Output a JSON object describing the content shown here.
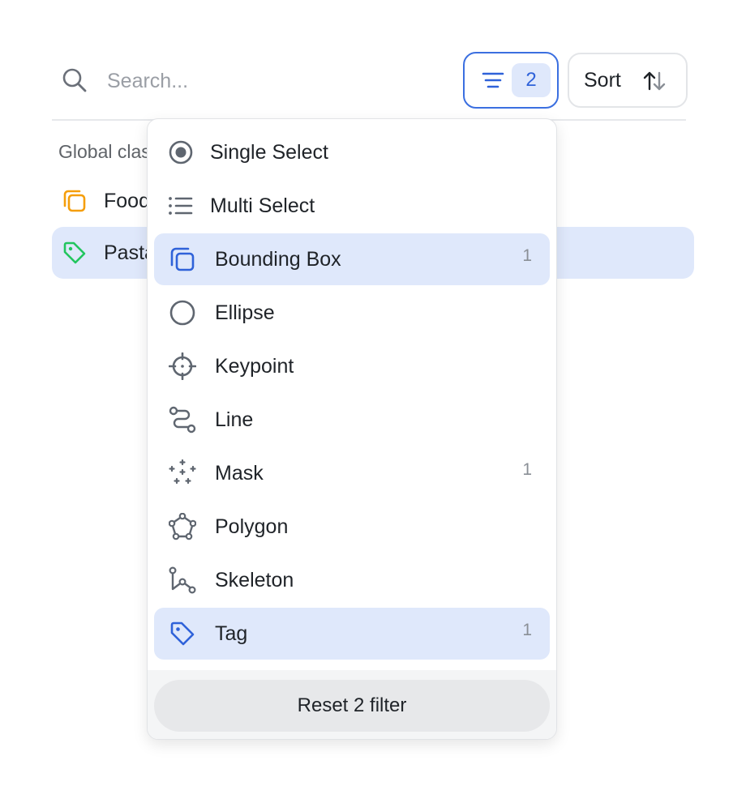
{
  "search": {
    "placeholder": "Search..."
  },
  "filter_button": {
    "count": "2"
  },
  "sort_button": {
    "label": "Sort"
  },
  "list": {
    "section_title": "Global classes",
    "items": [
      {
        "label": "Food",
        "icon": "bounding-box-icon",
        "color": "#f59e0b"
      },
      {
        "label": "Pasta",
        "icon": "tag-icon",
        "color": "#22c55e"
      }
    ]
  },
  "dropdown": {
    "items": [
      {
        "label": "Single Select",
        "icon": "radio-icon",
        "count": ""
      },
      {
        "label": "Multi Select",
        "icon": "list-icon",
        "count": ""
      },
      {
        "label": "Bounding Box",
        "icon": "bounding-box-icon",
        "count": "1"
      },
      {
        "label": "Ellipse",
        "icon": "ellipse-icon",
        "count": ""
      },
      {
        "label": "Keypoint",
        "icon": "keypoint-icon",
        "count": ""
      },
      {
        "label": "Line",
        "icon": "line-icon",
        "count": ""
      },
      {
        "label": "Mask",
        "icon": "mask-icon",
        "count": "1"
      },
      {
        "label": "Polygon",
        "icon": "polygon-icon",
        "count": ""
      },
      {
        "label": "Skeleton",
        "icon": "skeleton-icon",
        "count": ""
      },
      {
        "label": "Tag",
        "icon": "tag-icon",
        "count": "1"
      }
    ],
    "reset_label": "Reset 2 filter"
  },
  "colors": {
    "accent": "#3b6fe0",
    "accent_bg": "#dfe8fb",
    "icon_gray": "#5f6670"
  }
}
